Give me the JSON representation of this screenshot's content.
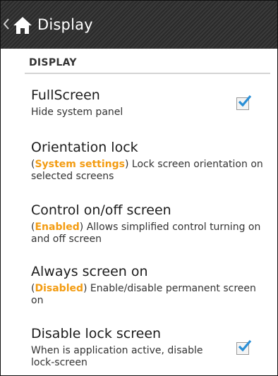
{
  "action_bar": {
    "title": "Display",
    "background": "#333333"
  },
  "section": {
    "header": "DISPLAY"
  },
  "settings": [
    {
      "title": "FullScreen",
      "summary": "Hide system panel",
      "checked": true
    },
    {
      "title": "Orientation lock",
      "status": "System settings",
      "summary_rest": " Lock screen orientation on selected screens"
    },
    {
      "title": "Control on/off screen",
      "status": "Enabled",
      "summary_rest": " Allows simplified control turning on and off screen"
    },
    {
      "title": "Always screen on",
      "status": "Disabled",
      "summary_rest": " Enable/disable permanent screen on"
    },
    {
      "title": "Disable lock screen",
      "summary": "When is application active, disable lock-screen",
      "checked": true
    }
  ],
  "colors": {
    "accent_status": "#f39c12",
    "checkmark": "#2a8fd6",
    "text_primary": "#1c1c1c"
  }
}
